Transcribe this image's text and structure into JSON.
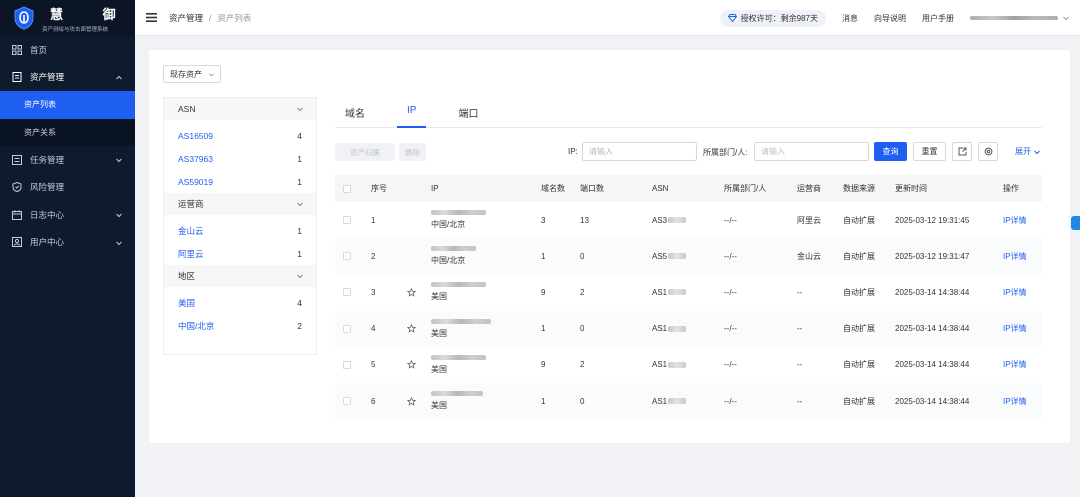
{
  "app": {
    "title": "慧 御",
    "subtitle": "资产测绘与攻击面管理系统"
  },
  "sidebar": {
    "items": [
      {
        "label": "首页",
        "icon": "grid-icon"
      },
      {
        "label": "资产管理",
        "icon": "file-icon",
        "open": true,
        "children": [
          {
            "label": "资产列表",
            "active": true
          },
          {
            "label": "资产关系"
          }
        ]
      },
      {
        "label": "任务管理",
        "icon": "task-icon"
      },
      {
        "label": "风险管理",
        "icon": "shield-icon"
      },
      {
        "label": "日志中心",
        "icon": "calendar-icon"
      },
      {
        "label": "用户中心",
        "icon": "user-icon"
      }
    ]
  },
  "header": {
    "breadcrumb": [
      "资产管理",
      "资产列表"
    ],
    "license": "授权许可：剩余987天",
    "links": [
      "消息",
      "向导说明",
      "用户手册"
    ]
  },
  "asset_select": {
    "value": "现存资产"
  },
  "filters": {
    "groups": [
      {
        "title": "ASN",
        "items": [
          {
            "label": "AS16509",
            "count": "4"
          },
          {
            "label": "AS37963",
            "count": "1"
          },
          {
            "label": "AS59019",
            "count": "1"
          }
        ]
      },
      {
        "title": "运营商",
        "items": [
          {
            "label": "金山云",
            "count": "1"
          },
          {
            "label": "阿里云",
            "count": "1"
          }
        ]
      },
      {
        "title": "地区",
        "items": [
          {
            "label": "美国",
            "count": "4"
          },
          {
            "label": "中国/北京",
            "count": "2"
          }
        ]
      }
    ]
  },
  "tabs": [
    {
      "label": "域名"
    },
    {
      "label": "IP",
      "active": true
    },
    {
      "label": "端口"
    }
  ],
  "toolbar": {
    "assign_label": "资产归属",
    "delete_label": "删除",
    "ip_label": "IP:",
    "ip_placeholder": "请输入",
    "dept_label": "所属部门/人:",
    "dept_placeholder": "请输入",
    "query_label": "查询",
    "reset_label": "重置",
    "expand_label": "展开"
  },
  "table": {
    "columns": [
      "序号",
      "IP",
      "域名数",
      "端口数",
      "ASN",
      "所属部门/人",
      "运营商",
      "数据来源",
      "更新时间",
      "操作"
    ],
    "rows": [
      {
        "no": "1",
        "starred": false,
        "location": "中国/北京",
        "domains": "3",
        "ports": "13",
        "asn_prefix": "AS3",
        "dept": "--/--",
        "isp": "阿里云",
        "source": "自动扩展",
        "updated": "2025-03-12 19:31:45",
        "action": "IP详情"
      },
      {
        "no": "2",
        "starred": false,
        "location": "中国/北京",
        "domains": "1",
        "ports": "0",
        "asn_prefix": "AS5",
        "dept": "--/--",
        "isp": "金山云",
        "source": "自动扩展",
        "updated": "2025-03-12 19:31:47",
        "action": "IP详情"
      },
      {
        "no": "3",
        "starred": true,
        "location": "美国",
        "domains": "9",
        "ports": "2",
        "asn_prefix": "AS1",
        "dept": "--/--",
        "isp": "--",
        "source": "自动扩展",
        "updated": "2025-03-14 14:38:44",
        "action": "IP详情"
      },
      {
        "no": "4",
        "starred": true,
        "location": "美国",
        "domains": "1",
        "ports": "0",
        "asn_prefix": "AS1",
        "dept": "--/--",
        "isp": "--",
        "source": "自动扩展",
        "updated": "2025-03-14 14:38:44",
        "action": "IP详情"
      },
      {
        "no": "5",
        "starred": true,
        "location": "美国",
        "domains": "9",
        "ports": "2",
        "asn_prefix": "AS1",
        "dept": "--/--",
        "isp": "--",
        "source": "自动扩展",
        "updated": "2025-03-14 14:38:44",
        "action": "IP详情"
      },
      {
        "no": "6",
        "starred": true,
        "location": "美国",
        "domains": "1",
        "ports": "0",
        "asn_prefix": "AS1",
        "dept": "--/--",
        "isp": "--",
        "source": "自动扩展",
        "updated": "2025-03-14 14:38:44",
        "action": "IP详情"
      }
    ]
  },
  "colors": {
    "accent": "#1e5ef1",
    "sidebar_bg": "#0e1a2e"
  }
}
